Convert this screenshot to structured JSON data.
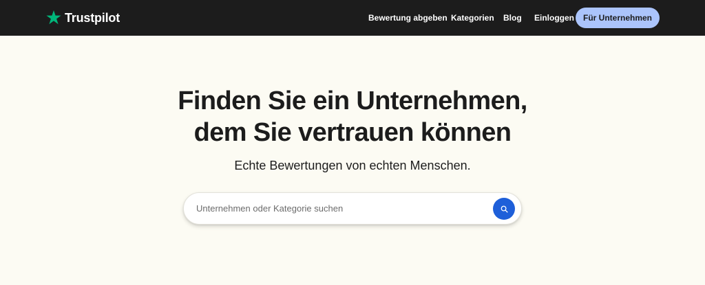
{
  "header": {
    "brand": "Trustpilot",
    "nav": [
      {
        "label": "Bewertung abgeben"
      },
      {
        "label": "Kategorien"
      },
      {
        "label": "Blog"
      },
      {
        "label": "Einloggen"
      }
    ],
    "cta_label": "Für Unternehmen"
  },
  "hero": {
    "title_line1": "Finden Sie ein Unternehmen,",
    "title_line2": "dem Sie vertrauen können",
    "subtitle": "Echte Bewertungen von echten Menschen."
  },
  "search": {
    "placeholder": "Unternehmen oder Kategorie suchen",
    "value": "",
    "button_icon": "search-icon"
  },
  "colors": {
    "header_bg": "#1c1c1c",
    "page_bg": "#fcfbf3",
    "brand_star": "#00b67a",
    "cta_bg": "#abc4fb",
    "search_button": "#1e5fd9"
  }
}
